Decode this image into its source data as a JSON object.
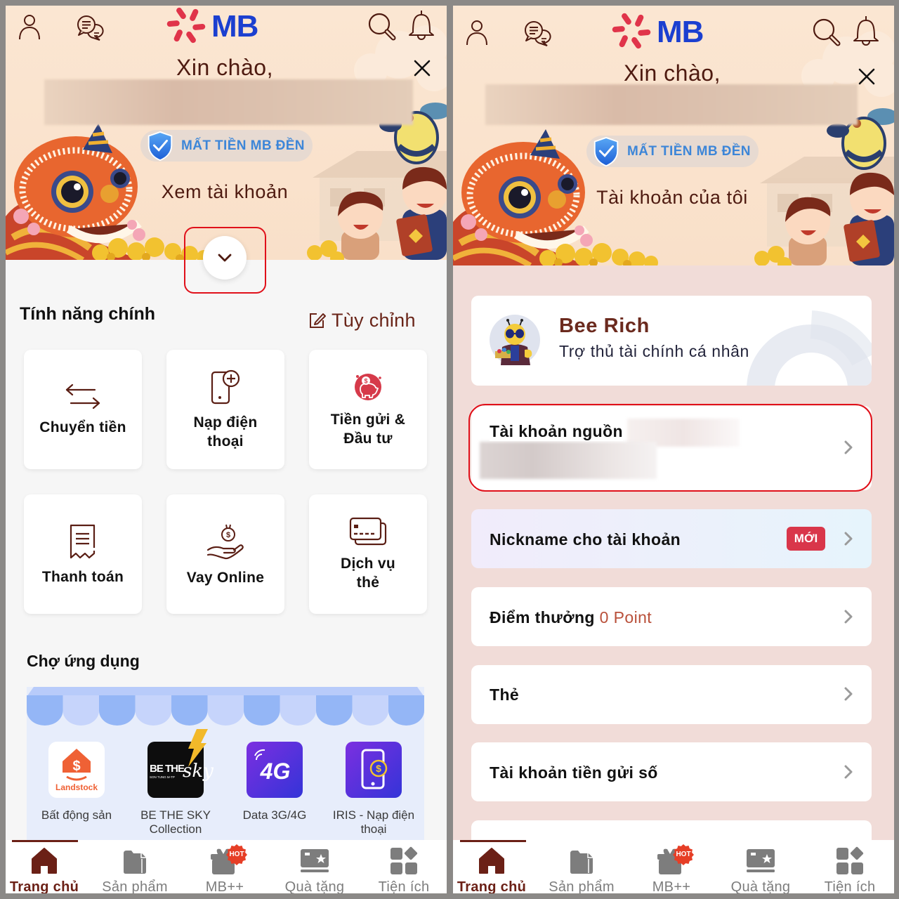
{
  "colors": {
    "brand_blue": "#1b3fd0",
    "brand_red": "#e0344a",
    "text_brown": "#4e1a10",
    "accent_brown": "#6b2016",
    "annotation_red": "#e0101a",
    "new_badge_red": "#d9364a",
    "hot_badge_red": "#e63e26",
    "points_color": "#b9503a",
    "nav_inactive": "#7d7d7d",
    "security_badge_blue": "#3d86d8"
  },
  "bottom_nav": {
    "items": [
      {
        "label": "Trang chủ",
        "icon": "home-icon",
        "active": true
      },
      {
        "label": "Sản phẩm",
        "icon": "folder-icon",
        "active": false
      },
      {
        "label": "MB++",
        "icon": "gift-icon",
        "badge": "HOT",
        "active": false
      },
      {
        "label": "Quà tặng",
        "icon": "reward-card-icon",
        "active": false
      },
      {
        "label": "Tiện ích",
        "icon": "utilities-icon",
        "active": false
      }
    ]
  },
  "left_screen": {
    "header": {
      "brand": "MB",
      "greeting": "Xin chào,",
      "security_badge": "MẤT TIỀN MB ĐỀN",
      "account_toggle_label": "Xem tài khoản",
      "expand_icon": "chevron-down-icon"
    },
    "main_features": {
      "title": "Tính năng chính",
      "customize_label": "Tùy chỉnh",
      "items": [
        {
          "icon": "transfer-icon",
          "label_lines": [
            "Chuyển tiền"
          ]
        },
        {
          "icon": "phone-topup-icon",
          "label_lines": [
            "Nạp điện",
            "thoại"
          ]
        },
        {
          "icon": "savings-investment-icon",
          "label_lines": [
            "Tiền gửi &",
            "Đầu tư"
          ]
        },
        {
          "icon": "bill-payment-icon",
          "label_lines": [
            "Thanh toán"
          ]
        },
        {
          "icon": "online-loan-icon",
          "label_lines": [
            "Vay Online"
          ]
        },
        {
          "icon": "card-service-icon",
          "label_lines": [
            "Dịch vụ",
            "thẻ"
          ]
        }
      ]
    },
    "app_market": {
      "title": "Chợ ứng dụng",
      "apps": [
        {
          "icon": "landstock-logo",
          "icon_text": "Landstock",
          "label_lines": [
            "Bất động sản"
          ]
        },
        {
          "icon": "be-the-sky-logo",
          "icon_text": "BE THE",
          "icon_script": "sky",
          "icon_subtext": "SON TUNG M-TP",
          "label_lines": [
            "BE THE SKY",
            "Collection"
          ]
        },
        {
          "icon": "data-4g-logo",
          "icon_text": "4G",
          "label_lines": [
            "Data 3G/4G"
          ]
        },
        {
          "icon": "iris-topup-logo",
          "icon_text": "$",
          "label_lines": [
            "IRIS - Nạp điện",
            "thoại"
          ]
        }
      ]
    }
  },
  "right_screen": {
    "header": {
      "brand": "MB",
      "greeting": "Xin chào,",
      "security_badge": "MẤT TIỀN MB ĐỀN",
      "account_toggle_label": "Tài khoản của tôi"
    },
    "assistant_card": {
      "name": "Bee Rich",
      "subtitle": "Trợ thủ tài chính cá nhân"
    },
    "account_menu": [
      {
        "label": "Tài khoản nguồn",
        "highlighted": true
      },
      {
        "label": "Nickname cho tài khoản",
        "badge": "MỚI"
      },
      {
        "label": "Điểm thưởng",
        "value": "0 Point"
      },
      {
        "label": "Thẻ"
      },
      {
        "label": "Tài khoản tiền gửi số"
      }
    ]
  }
}
